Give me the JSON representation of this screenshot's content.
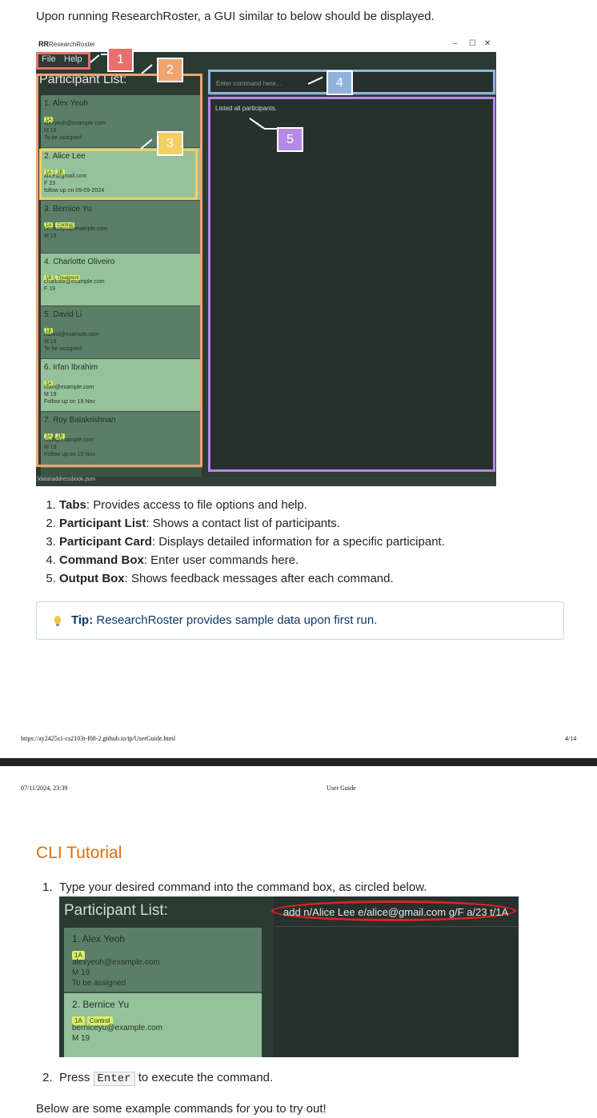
{
  "intro": "Upon running ResearchRoster, a GUI similar to below should be displayed.",
  "app": {
    "logo": "RR",
    "title": "ResearchRoster",
    "window_controls": {
      "minimize": "–",
      "maximize": "☐",
      "close": "✕"
    },
    "menu": {
      "file": "File",
      "help": "Help"
    },
    "list_title": "Participant List:",
    "command_placeholder": "Enter command here...",
    "output": "Listed all participants.",
    "status": ".\\data\\addressbook.json",
    "participants": [
      {
        "name": "1. Alex Yeoh",
        "tags": [
          "1A"
        ],
        "email": "alexyeoh@example.com",
        "info": "M   19",
        "note": "To be assigned"
      },
      {
        "name": "2. Alice Lee",
        "tags": [
          "1A",
          "2B"
        ],
        "email": "alice@gmail.com",
        "info": "F   23",
        "note": "follow up on 09-09-2024"
      },
      {
        "name": "3. Bernice Yu",
        "tags": [
          "1A",
          "Control"
        ],
        "email": "berniceyu@example.com",
        "info": "M   19",
        "note": ""
      },
      {
        "name": "4. Charlotte Oliveiro",
        "tags": [
          "1B",
          "Treatment"
        ],
        "email": "charlotte@example.com",
        "info": "F   19",
        "note": ""
      },
      {
        "name": "5. David Li",
        "tags": [
          "1B"
        ],
        "email": "lidavid@example.com",
        "info": "M   19",
        "note": "To be assigned"
      },
      {
        "name": "6. Irfan Ibrahim",
        "tags": [
          "2A"
        ],
        "email": "irfan@example.com",
        "info": "M   19",
        "note": "Follow up on 19 Nov"
      },
      {
        "name": "7. Roy Balakrishnan",
        "tags": [
          "2A",
          "2B"
        ],
        "email": "royb@example.com",
        "info": "M   19",
        "note": "Follow up on 19 Nov"
      }
    ]
  },
  "callouts": {
    "c1": "1",
    "c2": "2",
    "c3": "3",
    "c4": "4",
    "c5": "5",
    "colors": {
      "c1": "#e8706f",
      "c2": "#f0a470",
      "c3": "#f2cf63",
      "c4": "#8fb4dc",
      "c5": "#b888e8"
    }
  },
  "legend": [
    {
      "term": "Tabs",
      "desc": ": Provides access to file options and help."
    },
    {
      "term": "Participant List",
      "desc": ": Shows a contact list of participants."
    },
    {
      "term": "Participant Card",
      "desc": ": Displays detailed information for a specific participant."
    },
    {
      "term": "Command Box",
      "desc": ": Enter user commands here."
    },
    {
      "term": "Output Box",
      "desc": ": Shows feedback messages after each command."
    }
  ],
  "tip": {
    "label": "Tip:",
    "text": " ResearchRoster provides sample data upon first run."
  },
  "footer": {
    "url": "https://ay2425s1-cs2103t-f08-2.github.io/tp/UserGuide.html",
    "page": "4/14"
  },
  "header": {
    "datetime": "07/11/2024, 23:39",
    "title": "User Guide"
  },
  "cli": {
    "heading": "CLI Tutorial",
    "step1_num": "1.",
    "step1": "Type your desired command into the command box, as circled below.",
    "shot_title": "Participant List:",
    "shot_command": "add n/Alice Lee e/alice@gmail.com g/F a/23 t/1A",
    "shot_cards": [
      {
        "name": "1. Alex Yeoh",
        "tags": [
          "1A"
        ],
        "email": "alexyeoh@example.com",
        "info": "M   19",
        "note": "To be assigned"
      },
      {
        "name": "2. Bernice Yu",
        "tags": [
          "1A",
          "Control"
        ],
        "email": "berniceyu@example.com",
        "info": "M   19",
        "note": ""
      }
    ],
    "step2_num": "2.",
    "step2_pre": "Press ",
    "step2_key": "Enter",
    "step2_post": " to execute the command.",
    "bottom": "Below are some example commands for you to try out!"
  }
}
